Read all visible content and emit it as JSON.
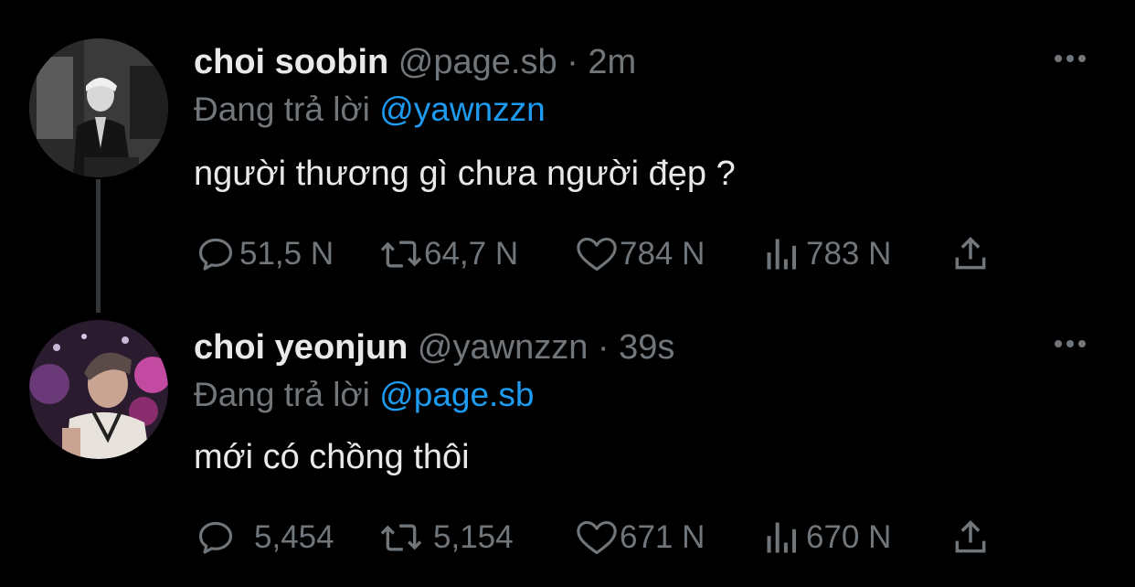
{
  "tweets": [
    {
      "display_name": "choi soobin",
      "handle": "@page.sb",
      "separator": "·",
      "time": "2m",
      "reply_prefix": "Đang trả lời",
      "reply_to": "@yawnzzn",
      "text": "người thương gì chưa người đẹp ?",
      "replies": "51,5 N",
      "retweets": "64,7 N",
      "likes": "784 N",
      "views": "783 N"
    },
    {
      "display_name": "choi yeonjun",
      "handle": "@yawnzzn",
      "separator": "·",
      "time": "39s",
      "reply_prefix": "Đang trả lời",
      "reply_to": "@page.sb",
      "text": "mới có chồng thôi",
      "replies": "5,454",
      "retweets": "5,154",
      "likes": "671 N",
      "views": "670 N"
    }
  ],
  "colors": {
    "background": "#000000",
    "primary_text": "#e7e9ea",
    "secondary_text": "#71767b",
    "accent": "#1d9bf0",
    "thread_line": "#333639"
  },
  "icons": [
    "reply-icon",
    "retweet-icon",
    "like-icon",
    "views-icon",
    "share-icon",
    "more-icon"
  ]
}
